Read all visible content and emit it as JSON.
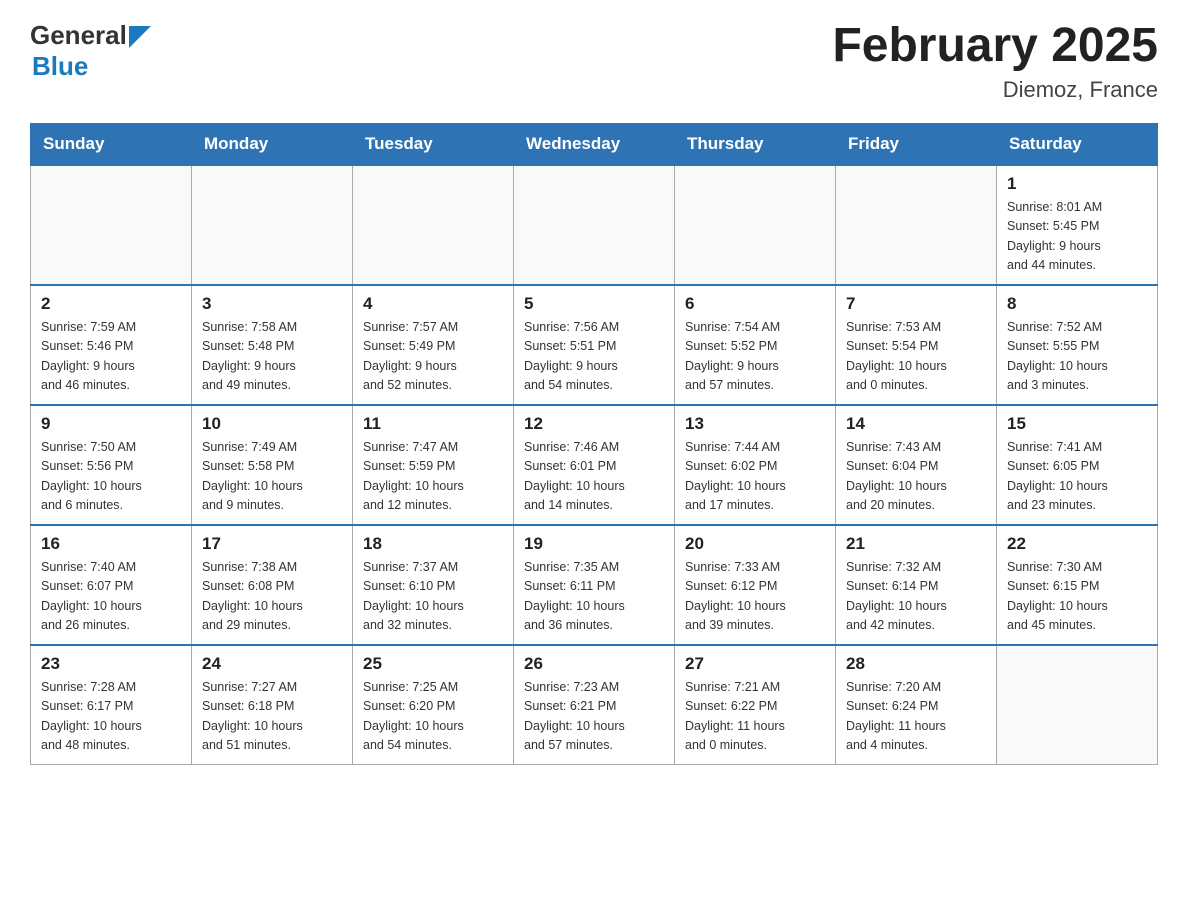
{
  "logo": {
    "text_general": "General",
    "text_blue": "Blue",
    "triangle_color": "#1a7abf"
  },
  "header": {
    "title": "February 2025",
    "subtitle": "Diemoz, France"
  },
  "days_of_week": [
    "Sunday",
    "Monday",
    "Tuesday",
    "Wednesday",
    "Thursday",
    "Friday",
    "Saturday"
  ],
  "weeks": [
    [
      {
        "day": "",
        "info": ""
      },
      {
        "day": "",
        "info": ""
      },
      {
        "day": "",
        "info": ""
      },
      {
        "day": "",
        "info": ""
      },
      {
        "day": "",
        "info": ""
      },
      {
        "day": "",
        "info": ""
      },
      {
        "day": "1",
        "info": "Sunrise: 8:01 AM\nSunset: 5:45 PM\nDaylight: 9 hours\nand 44 minutes."
      }
    ],
    [
      {
        "day": "2",
        "info": "Sunrise: 7:59 AM\nSunset: 5:46 PM\nDaylight: 9 hours\nand 46 minutes."
      },
      {
        "day": "3",
        "info": "Sunrise: 7:58 AM\nSunset: 5:48 PM\nDaylight: 9 hours\nand 49 minutes."
      },
      {
        "day": "4",
        "info": "Sunrise: 7:57 AM\nSunset: 5:49 PM\nDaylight: 9 hours\nand 52 minutes."
      },
      {
        "day": "5",
        "info": "Sunrise: 7:56 AM\nSunset: 5:51 PM\nDaylight: 9 hours\nand 54 minutes."
      },
      {
        "day": "6",
        "info": "Sunrise: 7:54 AM\nSunset: 5:52 PM\nDaylight: 9 hours\nand 57 minutes."
      },
      {
        "day": "7",
        "info": "Sunrise: 7:53 AM\nSunset: 5:54 PM\nDaylight: 10 hours\nand 0 minutes."
      },
      {
        "day": "8",
        "info": "Sunrise: 7:52 AM\nSunset: 5:55 PM\nDaylight: 10 hours\nand 3 minutes."
      }
    ],
    [
      {
        "day": "9",
        "info": "Sunrise: 7:50 AM\nSunset: 5:56 PM\nDaylight: 10 hours\nand 6 minutes."
      },
      {
        "day": "10",
        "info": "Sunrise: 7:49 AM\nSunset: 5:58 PM\nDaylight: 10 hours\nand 9 minutes."
      },
      {
        "day": "11",
        "info": "Sunrise: 7:47 AM\nSunset: 5:59 PM\nDaylight: 10 hours\nand 12 minutes."
      },
      {
        "day": "12",
        "info": "Sunrise: 7:46 AM\nSunset: 6:01 PM\nDaylight: 10 hours\nand 14 minutes."
      },
      {
        "day": "13",
        "info": "Sunrise: 7:44 AM\nSunset: 6:02 PM\nDaylight: 10 hours\nand 17 minutes."
      },
      {
        "day": "14",
        "info": "Sunrise: 7:43 AM\nSunset: 6:04 PM\nDaylight: 10 hours\nand 20 minutes."
      },
      {
        "day": "15",
        "info": "Sunrise: 7:41 AM\nSunset: 6:05 PM\nDaylight: 10 hours\nand 23 minutes."
      }
    ],
    [
      {
        "day": "16",
        "info": "Sunrise: 7:40 AM\nSunset: 6:07 PM\nDaylight: 10 hours\nand 26 minutes."
      },
      {
        "day": "17",
        "info": "Sunrise: 7:38 AM\nSunset: 6:08 PM\nDaylight: 10 hours\nand 29 minutes."
      },
      {
        "day": "18",
        "info": "Sunrise: 7:37 AM\nSunset: 6:10 PM\nDaylight: 10 hours\nand 32 minutes."
      },
      {
        "day": "19",
        "info": "Sunrise: 7:35 AM\nSunset: 6:11 PM\nDaylight: 10 hours\nand 36 minutes."
      },
      {
        "day": "20",
        "info": "Sunrise: 7:33 AM\nSunset: 6:12 PM\nDaylight: 10 hours\nand 39 minutes."
      },
      {
        "day": "21",
        "info": "Sunrise: 7:32 AM\nSunset: 6:14 PM\nDaylight: 10 hours\nand 42 minutes."
      },
      {
        "day": "22",
        "info": "Sunrise: 7:30 AM\nSunset: 6:15 PM\nDaylight: 10 hours\nand 45 minutes."
      }
    ],
    [
      {
        "day": "23",
        "info": "Sunrise: 7:28 AM\nSunset: 6:17 PM\nDaylight: 10 hours\nand 48 minutes."
      },
      {
        "day": "24",
        "info": "Sunrise: 7:27 AM\nSunset: 6:18 PM\nDaylight: 10 hours\nand 51 minutes."
      },
      {
        "day": "25",
        "info": "Sunrise: 7:25 AM\nSunset: 6:20 PM\nDaylight: 10 hours\nand 54 minutes."
      },
      {
        "day": "26",
        "info": "Sunrise: 7:23 AM\nSunset: 6:21 PM\nDaylight: 10 hours\nand 57 minutes."
      },
      {
        "day": "27",
        "info": "Sunrise: 7:21 AM\nSunset: 6:22 PM\nDaylight: 11 hours\nand 0 minutes."
      },
      {
        "day": "28",
        "info": "Sunrise: 7:20 AM\nSunset: 6:24 PM\nDaylight: 11 hours\nand 4 minutes."
      },
      {
        "day": "",
        "info": ""
      }
    ]
  ]
}
